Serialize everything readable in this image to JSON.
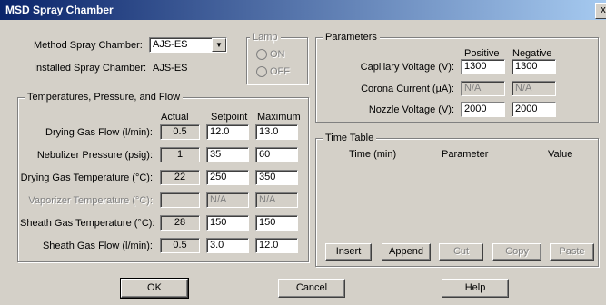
{
  "window": {
    "title": "MSD Spray Chamber",
    "close_glyph": "x"
  },
  "chamber": {
    "method_label": "Method Spray Chamber:",
    "method_value": "AJS-ES",
    "installed_label": "Installed Spray Chamber:",
    "installed_value": "AJS-ES"
  },
  "lamp": {
    "title": "Lamp",
    "on": "ON",
    "off": "OFF"
  },
  "tpf": {
    "title": "Temperatures, Pressure, and Flow",
    "col_actual": "Actual",
    "col_setpoint": "Setpoint",
    "col_maximum": "Maximum",
    "rows": [
      {
        "label": "Drying Gas Flow (l/min):",
        "actual": "0.5",
        "setpoint": "12.0",
        "maximum": "13.0"
      },
      {
        "label": "Nebulizer Pressure (psig):",
        "actual": "1",
        "setpoint": "35",
        "maximum": "60"
      },
      {
        "label": "Drying Gas Temperature (°C):",
        "actual": "22",
        "setpoint": "250",
        "maximum": "350"
      },
      {
        "label": "Vaporizer Temperature (°C):",
        "actual": "",
        "setpoint": "N/A",
        "maximum": "N/A"
      },
      {
        "label": "Sheath Gas  Temperature (°C):",
        "actual": "28",
        "setpoint": "150",
        "maximum": "150"
      },
      {
        "label": "Sheath Gas Flow (l/min):",
        "actual": "0.5",
        "setpoint": "3.0",
        "maximum": "12.0"
      }
    ]
  },
  "parameters": {
    "title": "Parameters",
    "col_positive": "Positive",
    "col_negative": "Negative",
    "rows": [
      {
        "label": "Capillary Voltage (V):",
        "positive": "1300",
        "negative": "1300"
      },
      {
        "label": "Corona Current (µA):",
        "positive": "N/A",
        "negative": "N/A"
      },
      {
        "label": "Nozzle Voltage (V):",
        "positive": "2000",
        "negative": "2000"
      }
    ]
  },
  "timetable": {
    "title": "Time Table",
    "col_time": "Time (min)",
    "col_parameter": "Parameter",
    "col_value": "Value",
    "buttons": {
      "insert": "Insert",
      "append": "Append",
      "cut": "Cut",
      "copy": "Copy",
      "paste": "Paste"
    }
  },
  "footer": {
    "ok": "OK",
    "cancel": "Cancel",
    "help": "Help"
  }
}
